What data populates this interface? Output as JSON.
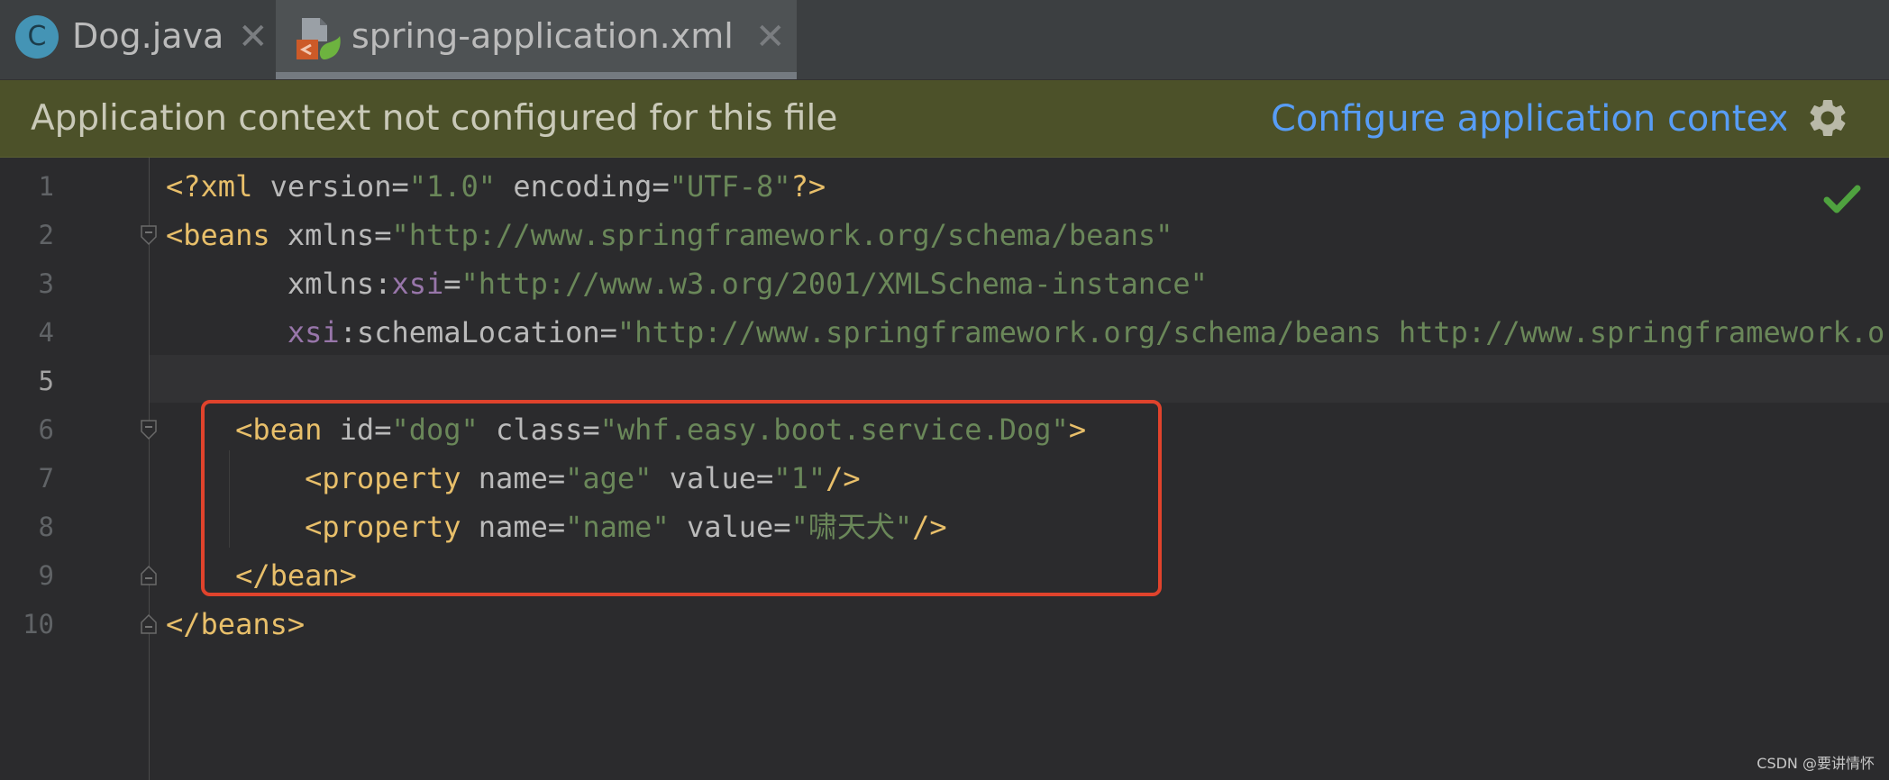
{
  "tabs": [
    {
      "label": "Dog.java",
      "icon": "java-class-icon",
      "icon_letter": "C",
      "active": false
    },
    {
      "label": "spring-application.xml",
      "icon": "spring-xml-icon",
      "active": true
    }
  ],
  "tab_close_symbol": "✕",
  "banner": {
    "message": "Application context not configured for this file",
    "link": "Configure application context"
  },
  "status": {
    "inspection": "check-icon",
    "color": "#4fa23f"
  },
  "colors": {
    "accent": "#589df6",
    "tag": "#e8bf6a",
    "string": "#6a8759",
    "namespace": "#9876aa",
    "highlight_box": "#e0432c"
  },
  "editor": {
    "current_line": 5,
    "lines": [
      [
        {
          "t": "<?xml ",
          "c": "tag"
        },
        {
          "t": "version",
          "c": "attr"
        },
        {
          "t": "=",
          "c": "attr"
        },
        {
          "t": "\"1.0\"",
          "c": "val"
        },
        {
          "t": " encoding",
          "c": "attr"
        },
        {
          "t": "=",
          "c": "attr"
        },
        {
          "t": "\"UTF-8\"",
          "c": "val"
        },
        {
          "t": "?>",
          "c": "tag"
        }
      ],
      [
        {
          "t": "<beans ",
          "c": "tag"
        },
        {
          "t": "xmlns",
          "c": "attr"
        },
        {
          "t": "=",
          "c": "attr"
        },
        {
          "t": "\"http://www.springframework.org/schema/beans\"",
          "c": "val"
        }
      ],
      [
        {
          "t": "       xmlns:",
          "c": "attr"
        },
        {
          "t": "xsi",
          "c": "ns"
        },
        {
          "t": "=",
          "c": "attr"
        },
        {
          "t": "\"http://www.w3.org/2001/XMLSchema-instance\"",
          "c": "val"
        }
      ],
      [
        {
          "t": "       ",
          "c": "attr"
        },
        {
          "t": "xsi",
          "c": "ns"
        },
        {
          "t": ":schemaLocation",
          "c": "attr"
        },
        {
          "t": "=",
          "c": "attr"
        },
        {
          "t": "\"http://www.springframework.org/schema/beans http://www.springframework.or",
          "c": "val"
        }
      ],
      [],
      [
        {
          "t": "    <bean ",
          "c": "tag"
        },
        {
          "t": "id",
          "c": "attr"
        },
        {
          "t": "=",
          "c": "attr"
        },
        {
          "t": "\"dog\"",
          "c": "val"
        },
        {
          "t": " class",
          "c": "attr"
        },
        {
          "t": "=",
          "c": "attr"
        },
        {
          "t": "\"whf.easy.boot.service.Dog\"",
          "c": "val"
        },
        {
          "t": ">",
          "c": "tag"
        }
      ],
      [
        {
          "t": "        <property ",
          "c": "tag"
        },
        {
          "t": "name",
          "c": "attr"
        },
        {
          "t": "=",
          "c": "attr"
        },
        {
          "t": "\"age\"",
          "c": "val"
        },
        {
          "t": " value",
          "c": "attr"
        },
        {
          "t": "=",
          "c": "attr"
        },
        {
          "t": "\"1\"",
          "c": "val"
        },
        {
          "t": "/>",
          "c": "tag"
        }
      ],
      [
        {
          "t": "        <property ",
          "c": "tag"
        },
        {
          "t": "name",
          "c": "attr"
        },
        {
          "t": "=",
          "c": "attr"
        },
        {
          "t": "\"name\"",
          "c": "val"
        },
        {
          "t": " value",
          "c": "attr"
        },
        {
          "t": "=",
          "c": "attr"
        },
        {
          "t": "\"啸天犬\"",
          "c": "val"
        },
        {
          "t": "/>",
          "c": "tag"
        }
      ],
      [
        {
          "t": "    </bean>",
          "c": "tag"
        }
      ],
      [
        {
          "t": "</beans>",
          "c": "tag"
        }
      ]
    ],
    "line_numbers": [
      "1",
      "2",
      "3",
      "4",
      "5",
      "6",
      "7",
      "8",
      "9",
      "10"
    ],
    "fold_markers": [
      {
        "line": 2,
        "kind": "open"
      },
      {
        "line": 6,
        "kind": "open"
      },
      {
        "line": 9,
        "kind": "close"
      },
      {
        "line": 10,
        "kind": "close"
      }
    ]
  },
  "watermark": "CSDN @要讲情怀"
}
